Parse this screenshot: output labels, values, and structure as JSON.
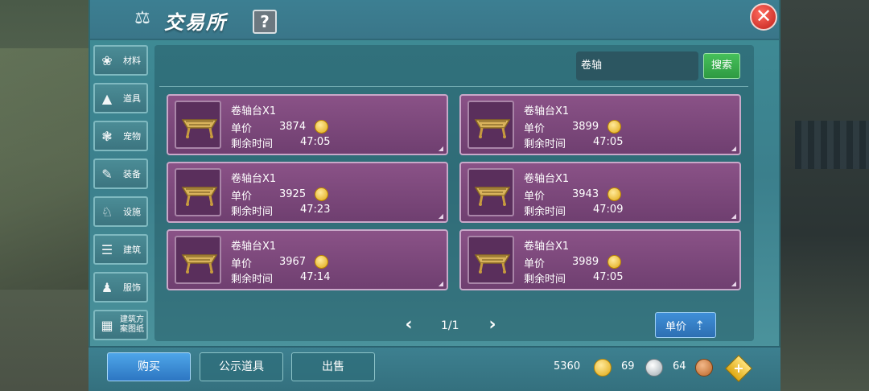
{
  "header": {
    "title": "交易所",
    "help_label": "?",
    "close_label": "✕"
  },
  "sidebar": {
    "items": [
      {
        "label": "材料",
        "icon": "materials-icon"
      },
      {
        "label": "道具",
        "icon": "item-icon"
      },
      {
        "label": "宠物",
        "icon": "paw-icon"
      },
      {
        "label": "装备",
        "icon": "equipment-icon"
      },
      {
        "label": "设施",
        "icon": "facility-icon"
      },
      {
        "label": "建筑",
        "icon": "building-icon"
      },
      {
        "label": "服饰",
        "icon": "clothing-icon"
      },
      {
        "label": "建筑方案图纸",
        "icon": "blueprint-icon"
      }
    ]
  },
  "search": {
    "value": "卷轴",
    "button_label": "搜索"
  },
  "listings": [
    {
      "name": "卷轴台X1",
      "price_label": "单价",
      "price": "3874",
      "time_label": "剩余时间",
      "time": "47:05"
    },
    {
      "name": "卷轴台X1",
      "price_label": "单价",
      "price": "3899",
      "time_label": "剩余时间",
      "time": "47:05"
    },
    {
      "name": "卷轴台X1",
      "price_label": "单价",
      "price": "3925",
      "time_label": "剩余时间",
      "time": "47:23"
    },
    {
      "name": "卷轴台X1",
      "price_label": "单价",
      "price": "3943",
      "time_label": "剩余时间",
      "time": "47:09"
    },
    {
      "name": "卷轴台X1",
      "price_label": "单价",
      "price": "3967",
      "time_label": "剩余时间",
      "time": "47:14"
    },
    {
      "name": "卷轴台X1",
      "price_label": "单价",
      "price": "3989",
      "time_label": "剩余时间",
      "time": "47:05"
    }
  ],
  "pagination": {
    "page": "1/1"
  },
  "sort": {
    "label": "单价"
  },
  "bottom": {
    "buy_label": "购买",
    "public_label": "公示道具",
    "sell_label": "出售",
    "gold": "5360",
    "silver": "69",
    "bronze": "64"
  },
  "colors": {
    "accent": "#3f8d97",
    "card": "#7a4779",
    "search_button": "#3aad4e",
    "buy_button": "#3b8ed6"
  }
}
